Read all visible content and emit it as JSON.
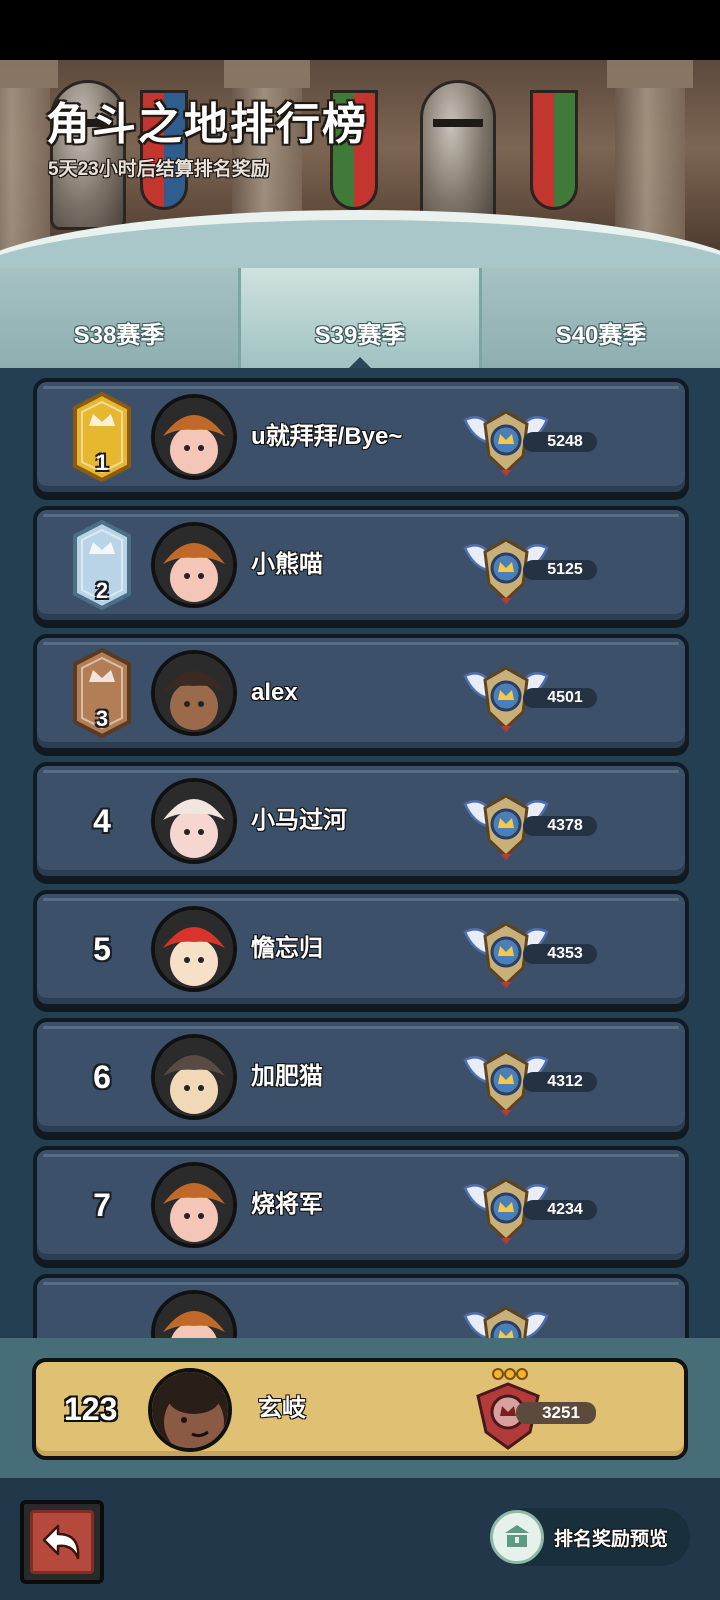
{
  "header": {
    "title": "角斗之地排行榜",
    "subtitle": "5天23小时后结算排名奖励"
  },
  "tabs": [
    {
      "label": "S38赛季",
      "active": false
    },
    {
      "label": "S39赛季",
      "active": true
    },
    {
      "label": "S40赛季",
      "active": false
    }
  ],
  "leaderboard": [
    {
      "rank": "1",
      "name": "u就拜拜/Bye~",
      "score": "5248",
      "badge": "gold-crown-badge",
      "avatar": "pumpkin-hat-avatar"
    },
    {
      "rank": "2",
      "name": "小熊喵",
      "score": "5125",
      "badge": "silver-moon-badge",
      "avatar": "pumpkin-hat-avatar"
    },
    {
      "rank": "3",
      "name": "alex",
      "score": "4501",
      "badge": "bronze-star-badge",
      "avatar": "cowboy-hat-avatar"
    },
    {
      "rank": "4",
      "name": "小马过河",
      "score": "4378",
      "badge": "",
      "avatar": "mustache-pig-avatar"
    },
    {
      "rank": "5",
      "name": "憺忘归",
      "score": "4353",
      "badge": "",
      "avatar": "strawberry-hat-avatar"
    },
    {
      "rank": "6",
      "name": "加肥猫",
      "score": "4312",
      "badge": "",
      "avatar": "goggles-cap-avatar"
    },
    {
      "rank": "7",
      "name": "烧将军",
      "score": "4234",
      "badge": "",
      "avatar": "pumpkin-hat-avatar"
    },
    {
      "rank": "",
      "name": "",
      "score": "",
      "badge": "",
      "avatar": "pumpkin-hat-avatar"
    }
  ],
  "my_entry": {
    "rank": "123",
    "name": "玄岐",
    "score": "3251",
    "avatar": "bald-head-avatar"
  },
  "bottom": {
    "back_icon": "back-arrow-icon",
    "reward_preview_label": "排名奖励预览"
  },
  "colors": {
    "row_bg": "#3c5169",
    "my_row_bg": "#e0c173",
    "tab_active": "#cfe2df",
    "list_bg": "#243f52"
  }
}
